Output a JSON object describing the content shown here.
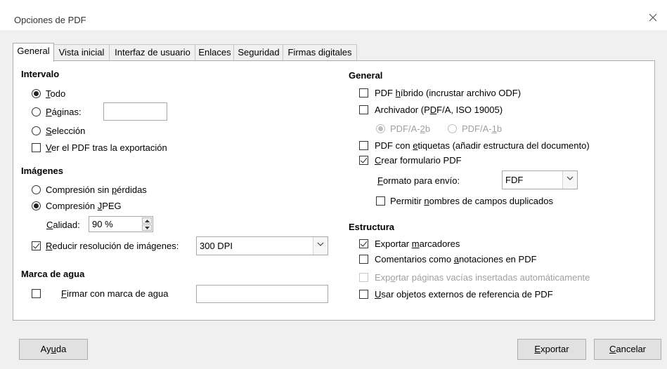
{
  "window": {
    "title": "Opciones de PDF"
  },
  "tabs": [
    "General",
    "Vista inicial",
    "Interfaz de usuario",
    "Enlaces",
    "Seguridad",
    "Firmas digitales"
  ],
  "interval": {
    "heading": "Intervalo",
    "all": "Todo",
    "pages": "Páginas:",
    "pages_value": "",
    "selection": "Selección",
    "view_after": "Ver el PDF tras la exportación",
    "selected": "all",
    "view_after_checked": false
  },
  "images": {
    "heading": "Imágenes",
    "lossless": "Compresión sin pérdidas",
    "jpeg": "Compresión JPEG",
    "selected": "jpeg",
    "quality_label": "Calidad:",
    "quality_value": "90 %",
    "reduce_label": "Reducir resolución de imágenes:",
    "reduce_checked": true,
    "resolution_value": "300 DPI"
  },
  "watermark": {
    "heading": "Marca de agua",
    "sign_label": "Firmar con marca de agua",
    "sign_checked": false,
    "value": ""
  },
  "general": {
    "heading": "General",
    "hybrid": "PDF híbrido (incrustar archivo ODF)",
    "hybrid_checked": false,
    "archive": "Archivador (PDF/A, ISO 19005)",
    "archive_checked": false,
    "pdfa2b": "PDF/A-2b",
    "pdfa1b": "PDF/A-1b",
    "tagged": "PDF con etiquetas (añadir estructura del documento)",
    "tagged_checked": false,
    "form": "Crear formulario PDF",
    "form_checked": true,
    "submit_format_label": "Formato para envío:",
    "submit_format_value": "FDF",
    "duplicate_names": "Permitir nombres de campos duplicados",
    "duplicate_checked": false
  },
  "structure": {
    "heading": "Estructura",
    "bookmarks": "Exportar marcadores",
    "bookmarks_checked": true,
    "comments": "Comentarios como anotaciones en PDF",
    "comments_checked": false,
    "empty_pages": "Exportar páginas vacías insertadas automáticamente",
    "empty_pages_checked": false,
    "external": "Usar objetos externos de referencia de PDF",
    "external_checked": false
  },
  "buttons": {
    "help": "Ayuda",
    "export": "Exportar",
    "cancel": "Cancelar"
  }
}
